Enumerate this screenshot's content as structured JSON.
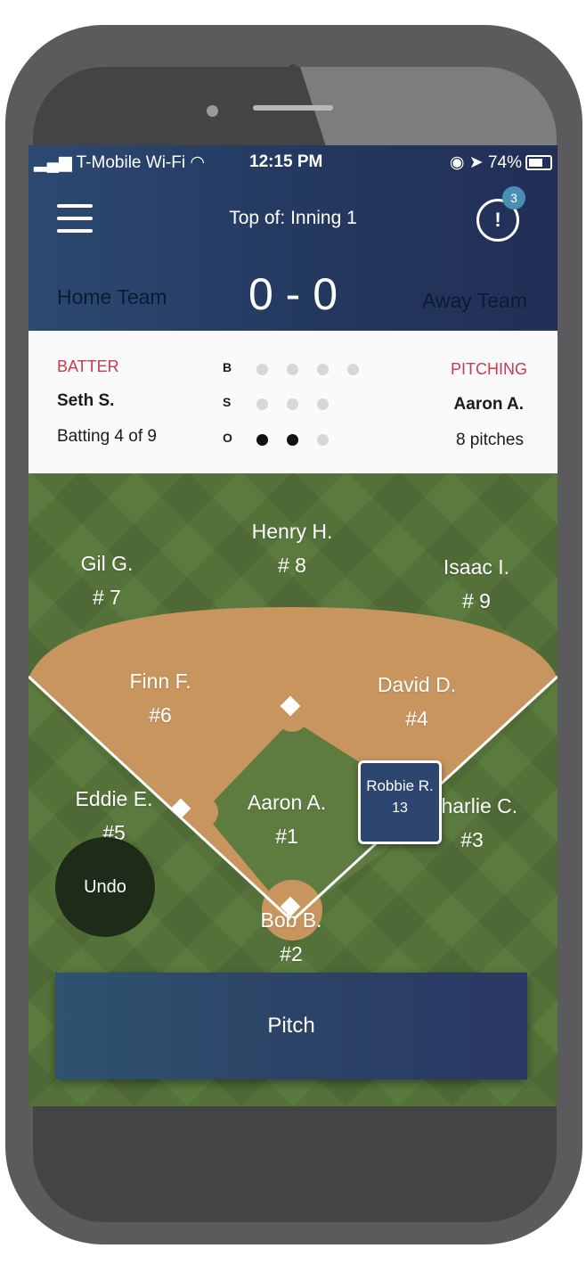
{
  "status_bar": {
    "carrier": "T-Mobile Wi-Fi",
    "time": "12:15 PM",
    "battery_text": "74%",
    "battery_level": 0.74
  },
  "header": {
    "inning_label": "Top of: Inning 1",
    "alert_icon_text": "!",
    "alert_count": "3",
    "home_team": "Home Team",
    "away_team": "Away Team",
    "score": "0 - 0"
  },
  "info": {
    "batter_label": "BATTER",
    "batter_name": "Seth S.",
    "batting_order": "Batting 4 of 9",
    "pitching_label": "PITCHING",
    "pitcher_name": "Aaron A.",
    "pitch_count": "8 pitches",
    "count": [
      {
        "key": "B",
        "total": 4,
        "filled": 0
      },
      {
        "key": "S",
        "total": 3,
        "filled": 0
      },
      {
        "key": "O",
        "total": 3,
        "filled": 2
      }
    ]
  },
  "field": {
    "players": [
      {
        "name": "Henry H.",
        "number": "# 8"
      },
      {
        "name": "Gil G.",
        "number": "# 7"
      },
      {
        "name": "Isaac I.",
        "number": "# 9"
      },
      {
        "name": "Finn F.",
        "number": "#6"
      },
      {
        "name": "David D.",
        "number": "#4"
      },
      {
        "name": "Eddie E.",
        "number": "#5"
      },
      {
        "name": "Aaron A.",
        "number": "#1"
      },
      {
        "name": "Charlie C.",
        "number": "#3"
      },
      {
        "name": "Bob B.",
        "number": "#2"
      }
    ],
    "dragged_player": {
      "name": "Robbie R.",
      "number": "13"
    },
    "colors": {
      "grass": "#5b7a3e",
      "dirt": "#c8955f",
      "lines": "#ffffff"
    }
  },
  "actions": {
    "undo_label": "Undo",
    "pitch_label": "Pitch"
  },
  "colors": {
    "header_navy": "#24385f",
    "accent_red": "#c93a51",
    "badge_blue": "#4a8fb3"
  }
}
